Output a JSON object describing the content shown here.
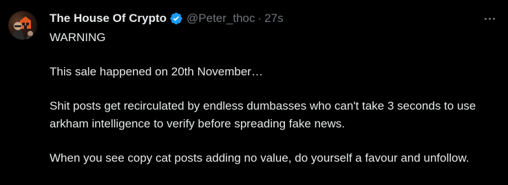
{
  "tweet": {
    "display_name": "The House Of Crypto",
    "handle": "@Peter_thoc",
    "separator": "·",
    "time": "27s",
    "verified_icon": "verified-badge-icon",
    "avatar_icon": "avatar-image",
    "more_icon": "more-options-icon",
    "colors": {
      "background": "#000000",
      "text": "#e7e9ea",
      "muted": "#71767b",
      "verified": "#1d9bf0"
    },
    "paragraphs": {
      "p1": "WARNING",
      "p2": "This sale happened on 20th November…",
      "p3": "Shit posts get recirculated by endless dumbasses who can't take 3 seconds to use arkham intelligence to verify before spreading fake news.",
      "p4": "When you see copy cat posts adding no value, do yourself a favour and unfollow."
    }
  }
}
